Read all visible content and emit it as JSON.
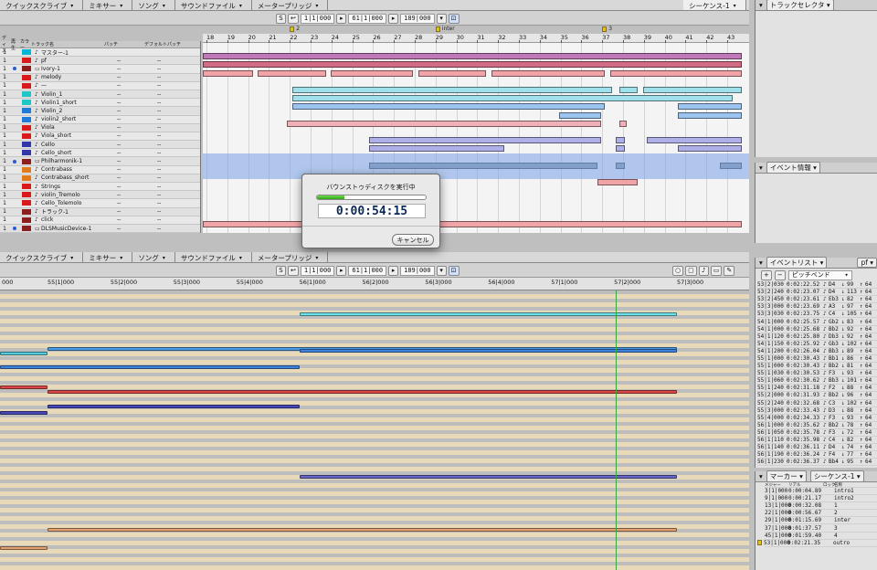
{
  "top_tabs": [
    "クイックスクライブ",
    "ミキサー",
    "ソング",
    "サウンドファイル",
    "メータープリッジ"
  ],
  "right_top_tab": "シーケンス-1",
  "toolbar": {
    "s_btn": "S",
    "field1": "1|1|000",
    "field2": "61|1|000",
    "field3": "189|000"
  },
  "track_header": [
    "ディス",
    "再生",
    "カラー",
    "トラック名",
    "パッチ",
    "デフォルトパッチ"
  ],
  "tracks": [
    {
      "num": "1",
      "dot": false,
      "color": "#00b7d6",
      "icon": "♪",
      "name": "マスター-1"
    },
    {
      "num": "1",
      "dot": false,
      "color": "#d81a1a",
      "icon": "♪",
      "name": "pf"
    },
    {
      "num": "1",
      "dot": true,
      "color": "#8b1e1e",
      "icon": "▭",
      "name": "Ivory-1"
    },
    {
      "num": "1",
      "dot": false,
      "color": "#d81a1a",
      "icon": "♪",
      "name": "melody"
    },
    {
      "num": "1",
      "dot": false,
      "color": "#d81a1a",
      "icon": "♪",
      "name": "—"
    },
    {
      "num": "1",
      "dot": false,
      "color": "#1fc6c6",
      "icon": "♪",
      "name": "Violin_1"
    },
    {
      "num": "1",
      "dot": false,
      "color": "#1fc6c6",
      "icon": "♪",
      "name": "Violin1_short"
    },
    {
      "num": "1",
      "dot": false,
      "color": "#1f7bd8",
      "icon": "♪",
      "name": "Violin_2"
    },
    {
      "num": "1",
      "dot": false,
      "color": "#1f7bd8",
      "icon": "♪",
      "name": "violin2_short"
    },
    {
      "num": "1",
      "dot": false,
      "color": "#d81a1a",
      "icon": "♪",
      "name": "Viola"
    },
    {
      "num": "1",
      "dot": false,
      "color": "#d81a1a",
      "icon": "♪",
      "name": "Viola_short"
    },
    {
      "num": "1",
      "dot": false,
      "color": "#3236a8",
      "icon": "♪",
      "name": "Cello"
    },
    {
      "num": "1",
      "dot": false,
      "color": "#3236a8",
      "icon": "♪",
      "name": "Cello_short"
    },
    {
      "num": "1",
      "dot": true,
      "color": "#8b1e1e",
      "icon": "▭",
      "name": "Philharmonik-1"
    },
    {
      "num": "1",
      "dot": false,
      "color": "#e07a1a",
      "icon": "♪",
      "name": "Contrabass"
    },
    {
      "num": "1",
      "dot": false,
      "color": "#e07a1a",
      "icon": "♪",
      "name": "Contrabass_short"
    },
    {
      "num": "1",
      "dot": false,
      "color": "#d81a1a",
      "icon": "♪",
      "name": "Strings"
    },
    {
      "num": "1",
      "dot": false,
      "color": "#d81a1a",
      "icon": "♪",
      "name": "violin_Tremolo"
    },
    {
      "num": "1",
      "dot": false,
      "color": "#d81a1a",
      "icon": "♪",
      "name": "Cello_Tolemolo"
    },
    {
      "num": "1",
      "dot": false,
      "color": "#8b1e1e",
      "icon": "♪",
      "name": "トラック-1"
    },
    {
      "num": "1",
      "dot": false,
      "color": "#8b1e1e",
      "icon": "♪",
      "name": "click"
    },
    {
      "num": "1",
      "dot": true,
      "color": "#8b1e1e",
      "icon": "▭",
      "name": "DLSMusicDevice-1"
    }
  ],
  "bars": [
    "18",
    "19",
    "20",
    "21",
    "22",
    "23",
    "24",
    "25",
    "26",
    "27",
    "28",
    "29",
    "30",
    "31",
    "32",
    "33",
    "34",
    "35",
    "36",
    "37",
    "38",
    "39",
    "40",
    "41",
    "42",
    "43"
  ],
  "markers": [
    {
      "label": "2",
      "bar": "22"
    },
    {
      "label": "inter",
      "bar": "29"
    },
    {
      "label": "3",
      "bar": "37"
    }
  ],
  "track_selector": "トラックセレクタ",
  "event_info": "イベント情報",
  "event_list": {
    "title": "イベントリスト",
    "tab": "pf",
    "filter": "ピッチベンド"
  },
  "events": [
    [
      "53|2|030",
      "0:02:22.52",
      "D4",
      "99",
      "64"
    ],
    [
      "53|2|240",
      "0:02:23.07",
      "D4",
      "113",
      "64"
    ],
    [
      "53|2|450",
      "0:02:23.61",
      "Eb3",
      "82",
      "64"
    ],
    [
      "53|3|000",
      "0:02:23.69",
      "A3",
      "97",
      "64"
    ],
    [
      "53|3|030",
      "0:02:23.75",
      "C4",
      "105",
      "64"
    ],
    [
      "54|1|000",
      "0:02:25.57",
      "Gb2",
      "83",
      "64"
    ],
    [
      "54|1|000",
      "0:02:25.68",
      "Bb2",
      "92",
      "64"
    ],
    [
      "54|1|120",
      "0:02:25.80",
      "Db3",
      "92",
      "64"
    ],
    [
      "54|1|150",
      "0:02:25.92",
      "Gb3",
      "102",
      "64"
    ],
    [
      "54|1|200",
      "0:02:26.04",
      "Bb3",
      "89",
      "64"
    ],
    [
      "55|1|000",
      "0:02:30.43",
      "Bb1",
      "86",
      "64"
    ],
    [
      "55|1|000",
      "0:02:30.43",
      "Bb2",
      "81",
      "64"
    ],
    [
      "55|1|030",
      "0:02:30.53",
      "F3",
      "93",
      "64"
    ],
    [
      "55|1|060",
      "0:02:30.62",
      "Bb3",
      "101",
      "64"
    ],
    [
      "55|1|240",
      "0:02:31.18",
      "F2",
      "88",
      "64"
    ],
    [
      "55|2|000",
      "0:02:31.93",
      "Bb2",
      "96",
      "64"
    ],
    [
      "55|2|240",
      "0:02:32.68",
      "C3",
      "102",
      "64"
    ],
    [
      "55|3|000",
      "0:02:33.43",
      "D3",
      "88",
      "64"
    ],
    [
      "55|4|000",
      "0:02:34.33",
      "F3",
      "93",
      "64"
    ],
    [
      "56|1|000",
      "0:02:35.62",
      "Bb2",
      "78",
      "64"
    ],
    [
      "56|1|050",
      "0:02:35.78",
      "F3",
      "72",
      "64"
    ],
    [
      "56|1|110",
      "0:02:35.98",
      "C4",
      "82",
      "64"
    ],
    [
      "56|1|140",
      "0:02:36.11",
      "D4",
      "74",
      "64"
    ],
    [
      "56|1|190",
      "0:02:36.24",
      "F4",
      "77",
      "64"
    ],
    [
      "56|1|230",
      "0:02:36.37",
      "Bb4",
      "95",
      "64"
    ]
  ],
  "marker_list": {
    "title": "マーカー",
    "tab": "シーケンス-1",
    "header": [
      "メジャー",
      "リアル",
      "ロック",
      "名称"
    ],
    "rows": [
      [
        "3|1|000",
        "0:00:04.89",
        "",
        "intro1"
      ],
      [
        "9|1|000",
        "0:00:21.17",
        "",
        "intro2"
      ],
      [
        "13|1|000",
        "0:00:32.08",
        "",
        "1"
      ],
      [
        "22|1|000",
        "0:00:56.67",
        "",
        "2"
      ],
      [
        "29|1|000",
        "0:01:15.69",
        "",
        "inter"
      ],
      [
        "37|1|000",
        "0:01:37.57",
        "",
        "3"
      ],
      [
        "45|1|000",
        "0:01:59.40",
        "",
        "4"
      ],
      [
        "53|1|000",
        "0:02:21.35",
        "",
        "outro"
      ]
    ]
  },
  "piano_ruler": [
    "000",
    "55|1|000",
    "55|2|000",
    "55|3|000",
    "55|4|000",
    "56|1|000",
    "56|2|000",
    "56|3|000",
    "56|4|000",
    "57|1|000",
    "57|2|000",
    "57|3|000"
  ],
  "dialog": {
    "title": "バウンストゥディスクを実行中",
    "progress": 0.25,
    "timecode": "0:00:54:15",
    "cancel": "キャンセル"
  }
}
